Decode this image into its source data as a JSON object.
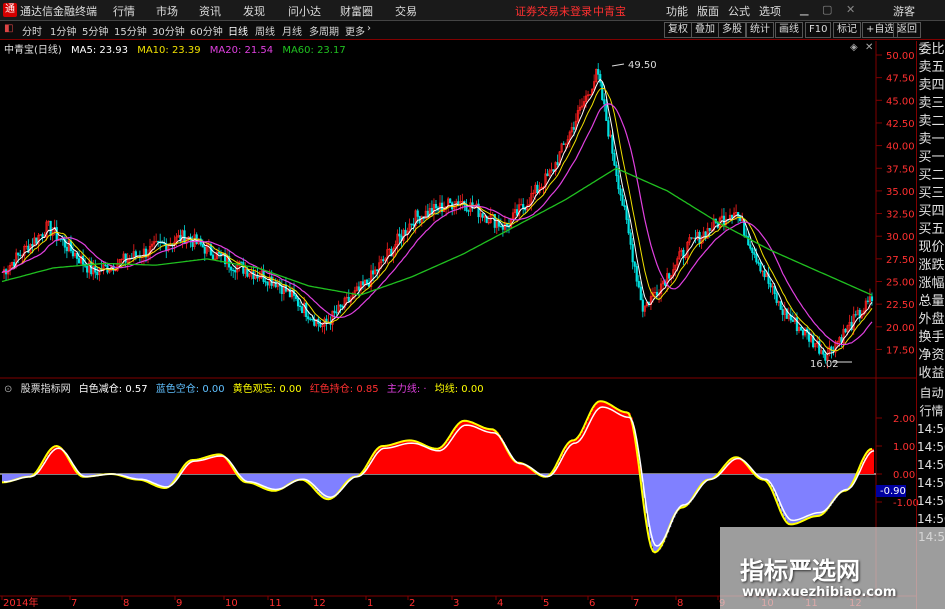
{
  "app": {
    "title": "通达信金融终端",
    "logo": "通"
  },
  "menus": [
    "行情",
    "市场",
    "资讯",
    "发现",
    "问小达",
    "财富圈",
    "交易"
  ],
  "warning": "证券交易未登录",
  "stock_name_top": "中青宝",
  "right_menus": [
    "功能",
    "版面",
    "公式",
    "选项"
  ],
  "guest": "游客",
  "periods": [
    "分时",
    "1分钟",
    "5分钟",
    "15分钟",
    "30分钟",
    "60分钟",
    "日线",
    "周线",
    "月线",
    "多周期",
    "更多"
  ],
  "toolbar_right": [
    "复权",
    "叠加",
    "多股",
    "统计",
    "画线",
    "F10",
    "标记",
    "+自选",
    "返回"
  ],
  "main_info": {
    "title": "中青宝(日线)",
    "ma5": "MA5: 23.93",
    "ma10": "MA10: 23.39",
    "ma20": "MA20: 21.54",
    "ma60": "MA60: 23.17"
  },
  "colors": {
    "ma5": "#ffffff",
    "ma10": "#f0e000",
    "ma20": "#e040e0",
    "ma60": "#20c020",
    "up": "#ff2020",
    "down": "#00e0e0",
    "fill_red": "#ff0000",
    "fill_blue": "#8080ff",
    "yellow": "#ffff00"
  },
  "price_labels": {
    "high": "49.50",
    "low": "16.02"
  },
  "y_axis_main": [
    "50.00",
    "47.50",
    "45.00",
    "42.50",
    "40.00",
    "37.50",
    "35.00",
    "32.50",
    "30.00",
    "27.50",
    "25.00",
    "22.50",
    "20.00",
    "17.50"
  ],
  "right_panel": [
    "委比",
    "卖五",
    "卖四",
    "卖三",
    "卖二",
    "卖一",
    "买一",
    "买二",
    "买三",
    "买四",
    "买五",
    "现价",
    "涨跌",
    "涨幅",
    "总量",
    "外盘",
    "换手",
    "净资",
    "收益"
  ],
  "indicator": {
    "name": "股票指标网",
    "white": "白色减仓: 0.57",
    "blue": "蓝色空仓: 0.00",
    "yellow": "黄色观忘: 0.00",
    "red": "红色持仓: 0.85",
    "main": "主力线: ·",
    "avg": "均线: 0.00"
  },
  "y_axis_ind": [
    "2.00",
    "1.00",
    "0.00",
    "-0.90",
    "-1.00"
  ],
  "ind_current": "-0.90",
  "right_panel2": [
    "自动",
    "行情",
    "14:50",
    "14:50",
    "14:50",
    "14:50",
    "14:50",
    "14:50",
    "14:5"
  ],
  "x_axis": [
    "2014年",
    "7",
    "8",
    "9",
    "10",
    "11",
    "12",
    "1",
    "2",
    "3",
    "4",
    "5",
    "6",
    "7",
    "8",
    "9",
    "10",
    "11",
    "12"
  ],
  "watermark": {
    "line1": "指标严选网",
    "line2": "www.xuezhibiao.com"
  },
  "chart_data": {
    "type": "line",
    "ma60": [
      25.0,
      26.5,
      27.0,
      26.8,
      27.5,
      26.5,
      24.5,
      23.5,
      25.5,
      28.0,
      31.0,
      34.0,
      37.5,
      35.0,
      31.5,
      28.5,
      26.0,
      23.5
    ],
    "price": [
      26,
      31,
      26,
      28,
      30,
      27,
      25,
      20,
      25,
      32,
      34,
      31,
      37,
      48,
      22,
      29,
      33,
      22,
      17,
      23
    ]
  }
}
